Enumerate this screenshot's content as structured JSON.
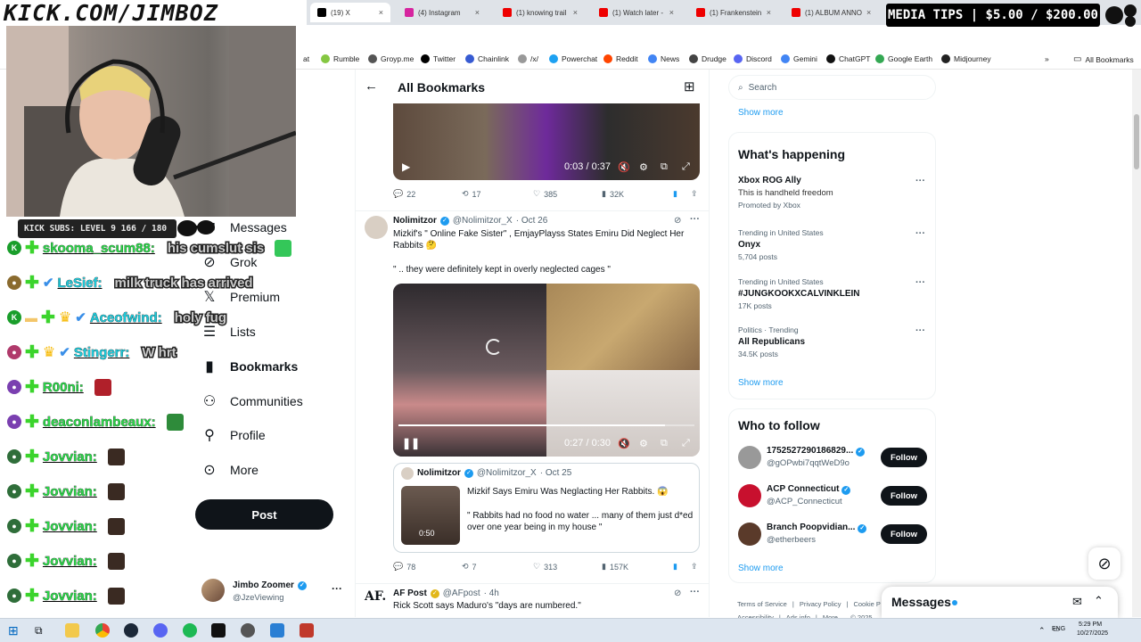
{
  "overlay": {
    "kick_url": "KICK.COM/JIMBOZ",
    "media_tips": "MEDIA TIPS | $5.00 / $200.00",
    "subs_bar": "KICK SUBS: LEVEL 9 166 / 180",
    "chat": [
      {
        "badge": "K",
        "badge_color": "#1a9e2b",
        "crown": false,
        "tick": false,
        "user": "skooma_scum88:",
        "user_color": "#2dd44a",
        "msg": "his cumslut sis",
        "emote": "#34c759"
      },
      {
        "badge": "",
        "badge_color": "#8a6b2f",
        "crown": false,
        "tick": true,
        "user": "LeSief:",
        "user_color": "#1ec9d9",
        "msg": "milk truck has arrived",
        "emote": ""
      },
      {
        "badge": "K",
        "badge_color": "#1a9e2b",
        "crown": true,
        "tick": true,
        "user": "Aceofwind:",
        "user_color": "#1ec9d9",
        "msg": "holy fug",
        "emote": ""
      },
      {
        "badge": "",
        "badge_color": "#b03a6b",
        "crown": true,
        "tick": true,
        "user": "Stingerr:",
        "user_color": "#1ec9d9",
        "msg": "W hrt",
        "emote": ""
      },
      {
        "badge": "",
        "badge_color": "#7a3fb0",
        "crown": false,
        "tick": false,
        "user": "R00ni:",
        "user_color": "#2dd44a",
        "msg": "",
        "emote": "#b0202a"
      },
      {
        "badge": "",
        "badge_color": "#7a3fb0",
        "crown": false,
        "tick": false,
        "user": "deaconlambeaux:",
        "user_color": "#2dd44a",
        "msg": "",
        "emote": "#2e8b3a"
      },
      {
        "badge": "",
        "badge_color": "#2f6e3a",
        "crown": false,
        "tick": false,
        "user": "Jovvian:",
        "user_color": "#2dd44a",
        "msg": "",
        "emote": "#3a2a22"
      },
      {
        "badge": "",
        "badge_color": "#2f6e3a",
        "crown": false,
        "tick": false,
        "user": "Jovvian:",
        "user_color": "#2dd44a",
        "msg": "",
        "emote": "#3a2a22"
      },
      {
        "badge": "",
        "badge_color": "#2f6e3a",
        "crown": false,
        "tick": false,
        "user": "Jovvian:",
        "user_color": "#2dd44a",
        "msg": "",
        "emote": "#3a2a22"
      },
      {
        "badge": "",
        "badge_color": "#2f6e3a",
        "crown": false,
        "tick": false,
        "user": "Jovvian:",
        "user_color": "#2dd44a",
        "msg": "",
        "emote": "#3a2a22"
      },
      {
        "badge": "",
        "badge_color": "#2f6e3a",
        "crown": false,
        "tick": false,
        "user": "Jovvian:",
        "user_color": "#2dd44a",
        "msg": "",
        "emote": "#3a2a22"
      }
    ]
  },
  "browser": {
    "tabs": [
      {
        "label": "(19) X",
        "active": true,
        "color": "#000"
      },
      {
        "label": "(4) Instagram",
        "active": false,
        "color": "#d6249f"
      },
      {
        "label": "(1) knowing trail",
        "active": false,
        "color": "#e00"
      },
      {
        "label": "(1) Watch later -",
        "active": false,
        "color": "#e00"
      },
      {
        "label": "(1) Frankenstein",
        "active": false,
        "color": "#e00"
      },
      {
        "label": "(1) ALBUM ANNO",
        "active": false,
        "color": "#e00"
      }
    ],
    "bookmarks": [
      {
        "label": "at",
        "color": "#888"
      },
      {
        "label": "Rumble",
        "color": "#85c742"
      },
      {
        "label": "Groyp.me",
        "color": "#555"
      },
      {
        "label": "Twitter",
        "color": "#000"
      },
      {
        "label": "Chainlink",
        "color": "#375bd2"
      },
      {
        "label": "/x/",
        "color": "#999"
      },
      {
        "label": "Powerchat",
        "color": "#1da1f2"
      },
      {
        "label": "Reddit",
        "color": "#ff4500"
      },
      {
        "label": "News",
        "color": "#4285f4"
      },
      {
        "label": "Drudge",
        "color": "#444"
      },
      {
        "label": "Discord",
        "color": "#5865f2"
      },
      {
        "label": "Gemini",
        "color": "#4285f4"
      },
      {
        "label": "ChatGPT",
        "color": "#111"
      },
      {
        "label": "Google Earth",
        "color": "#34a853"
      },
      {
        "label": "Midjourney",
        "color": "#222"
      }
    ],
    "all_bookmarks": "All Bookmarks"
  },
  "sidebar": {
    "items": [
      {
        "label": "Messages",
        "icon": "envelope-icon",
        "bold": false
      },
      {
        "label": "Grok",
        "icon": "grok-icon",
        "bold": false
      },
      {
        "label": "Premium",
        "icon": "x-logo-icon",
        "bold": false
      },
      {
        "label": "Lists",
        "icon": "list-icon",
        "bold": false
      },
      {
        "label": "Bookmarks",
        "icon": "bookmark-icon",
        "bold": true
      },
      {
        "label": "Communities",
        "icon": "communities-icon",
        "bold": false
      },
      {
        "label": "Profile",
        "icon": "person-icon",
        "bold": false
      },
      {
        "label": "More",
        "icon": "more-circle-icon",
        "bold": false
      }
    ],
    "post_label": "Post",
    "account": {
      "name": "Jimbo Zoomer",
      "handle": "@JzeViewing"
    }
  },
  "feed": {
    "title": "All Bookmarks",
    "tweet1": {
      "video_time": "0:03 / 0:37",
      "replies": "22",
      "reposts": "17",
      "likes": "385",
      "views": "32K"
    },
    "tweet2": {
      "name": "Nolimitzor",
      "handle": "@Nolimitzor_X",
      "date": "· Oct 26",
      "text1": "Mizkif's \" Online Fake Sister\" , EmjayPlayss States Emiru Did Neglect Her Rabbits 🤔",
      "text2": "\" .. they were definitely kept in overly neglected cages \"",
      "video_time": "0:27 / 0:30",
      "quote": {
        "name": "Nolimitzor",
        "handle": "@Nolimitzor_X",
        "date": "· Oct 25",
        "text1": "Mizkif Says Emiru Was Neglacting Her Rabbits. 😱",
        "text2": "\" Rabbits had no food no water ... many of them just d*ed over one year being in my house \"",
        "duration": "0:50"
      },
      "replies": "78",
      "reposts": "7",
      "likes": "313",
      "views": "157K"
    },
    "tweet3": {
      "name": "AF Post",
      "handle": "@AFpost",
      "date": "· 4h",
      "text": "Rick Scott says Maduro's \"days are numbered.\""
    }
  },
  "right": {
    "search_placeholder": "Search",
    "show_more": "Show more",
    "happening_title": "What's happening",
    "trends": [
      {
        "ctx": "",
        "title": "Xbox ROG Ally",
        "sub": "This is handheld freedom",
        "promo": "Promoted by Xbox"
      },
      {
        "ctx": "Trending in United States",
        "title": "Onyx",
        "count": "5,704 posts"
      },
      {
        "ctx": "Trending in United States",
        "title": "#JUNGKOOKXCALVINKLEIN",
        "count": "17K posts"
      },
      {
        "ctx": "Politics · Trending",
        "title": "All Republicans",
        "count": "34.5K posts"
      }
    ],
    "wtf_title": "Who to follow",
    "follow": [
      {
        "name": "1752527290186829...",
        "handle": "@gOPwbi7qqtWeD9o",
        "color": "#999"
      },
      {
        "name": "ACP Connecticut",
        "handle": "@ACP_Connecticut",
        "color": "#c8102e"
      },
      {
        "name": "Branch Poopvidian...",
        "handle": "@etherbeers",
        "color": "#5a3a2a"
      }
    ],
    "follow_label": "Follow",
    "footer": [
      "Terms of Service",
      "|",
      "Privacy Policy",
      "|",
      "Cookie P",
      "Accessibility",
      "|",
      "Ads info",
      "|",
      "More ...",
      "© 2025"
    ],
    "messages": "Messages"
  },
  "taskbar": {
    "lang": "ENG",
    "time": "5:29 PM",
    "date": "10/27/2025"
  }
}
